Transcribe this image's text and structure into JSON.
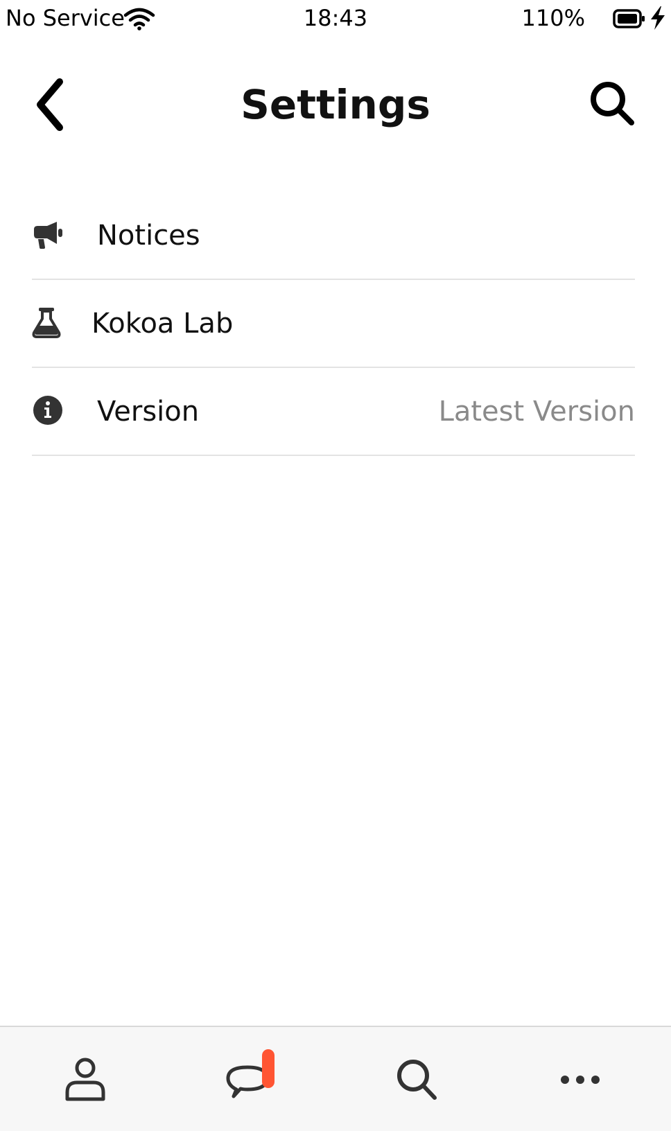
{
  "status_bar": {
    "carrier": "No Service",
    "time": "18:43",
    "battery_percent": "110%",
    "icons": [
      "wifi-icon",
      "battery-icon",
      "charging-bolt-icon"
    ]
  },
  "header": {
    "title": "Settings",
    "back_icon": "chevron-left-icon",
    "search_icon": "search-icon"
  },
  "settings": {
    "items": [
      {
        "label": "Notices",
        "icon": "megaphone-icon",
        "value": ""
      },
      {
        "label": "Kokoa Lab",
        "icon": "flask-icon",
        "value": ""
      },
      {
        "label": "Version",
        "icon": "info-circle-icon",
        "value": "Latest Version"
      }
    ]
  },
  "tab_bar": {
    "tabs": [
      {
        "name": "profile",
        "icon": "person-icon"
      },
      {
        "name": "chats",
        "icon": "chat-bubble-icon",
        "badge": ""
      },
      {
        "name": "search",
        "icon": "search-icon"
      },
      {
        "name": "more",
        "icon": "ellipsis-icon"
      }
    ]
  },
  "colors": {
    "background": "#ffffff",
    "text": "#111111",
    "secondary_text": "#8a8a8a",
    "divider": "#e3e3e3",
    "tab_bar_bg": "#f7f7f7",
    "badge": "#ff5533"
  }
}
